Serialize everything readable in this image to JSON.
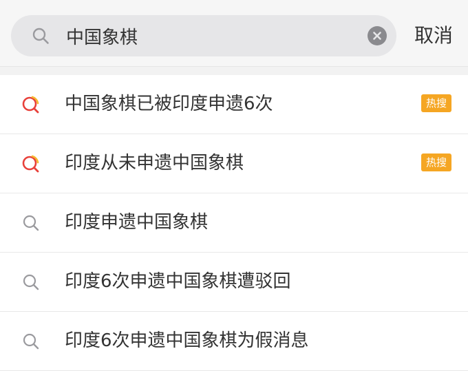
{
  "search": {
    "value": "中国象棋",
    "cancel_label": "取消"
  },
  "suggestions": [
    {
      "text": "中国象棋已被印度申遗6次",
      "hot": true,
      "badge": "热搜"
    },
    {
      "text": "印度从未申遗中国象棋",
      "hot": true,
      "badge": "热搜"
    },
    {
      "text": "印度申遗中国象棋",
      "hot": false
    },
    {
      "text": "印度6次申遗中国象棋遭驳回",
      "hot": false
    },
    {
      "text": "印度6次申遗中国象棋为假消息",
      "hot": false
    }
  ],
  "colors": {
    "badge": "#f5a623",
    "hot_icon_red": "#e8403a",
    "hot_icon_yellow": "#f5b82e",
    "search_field_bg": "#e6e6e8"
  }
}
